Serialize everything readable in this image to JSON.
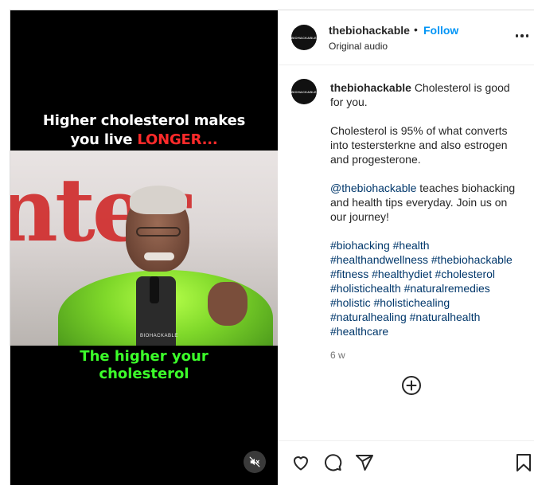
{
  "video": {
    "caption_top_line1": "Higher cholesterol makes",
    "caption_top_line2_prefix": "you live ",
    "caption_top_highlight": "LONGER...",
    "caption_bottom_line1": "The higher your",
    "caption_bottom_line2": "cholesterol",
    "watermark": "BIOHACKABLE",
    "caption_highlight_color": "#ff2a2a",
    "caption_bottom_color": "#3cff2a",
    "mute_icon": "speaker-muted-icon"
  },
  "header": {
    "avatar_text": "BIOHACKABLE",
    "username": "thebiohackable",
    "separator": "•",
    "follow_label": "Follow",
    "audio": "Original audio",
    "more_icon": "more-options-icon",
    "follow_color": "#0095f6"
  },
  "caption": {
    "username": "thebiohackable",
    "line1": "Cholesterol is good for you.",
    "para2": "Cholesterol is 95% of what converts into testersterkne and also estrogen and progesterone.",
    "mention": "@thebiohackable",
    "para3_rest": " teaches biohacking and health tips everyday. Join us on our journey!",
    "hashtags": [
      "#biohacking",
      "#health",
      "#healthandwellness",
      "#thebiohackable",
      "#fitness",
      "#healthydiet",
      "#cholesterol",
      "#holistichealth",
      "#naturalremedies",
      "#holistic",
      "#holistichealing",
      "#naturalhealing",
      "#naturalhealth",
      "#healthcare"
    ],
    "time_ago": "6 w",
    "link_color": "#00376b"
  },
  "load_more_icon": "plus-circle-icon",
  "actions": {
    "like_icon": "heart-icon",
    "comment_icon": "comment-icon",
    "share_icon": "share-icon",
    "save_icon": "bookmark-icon"
  }
}
